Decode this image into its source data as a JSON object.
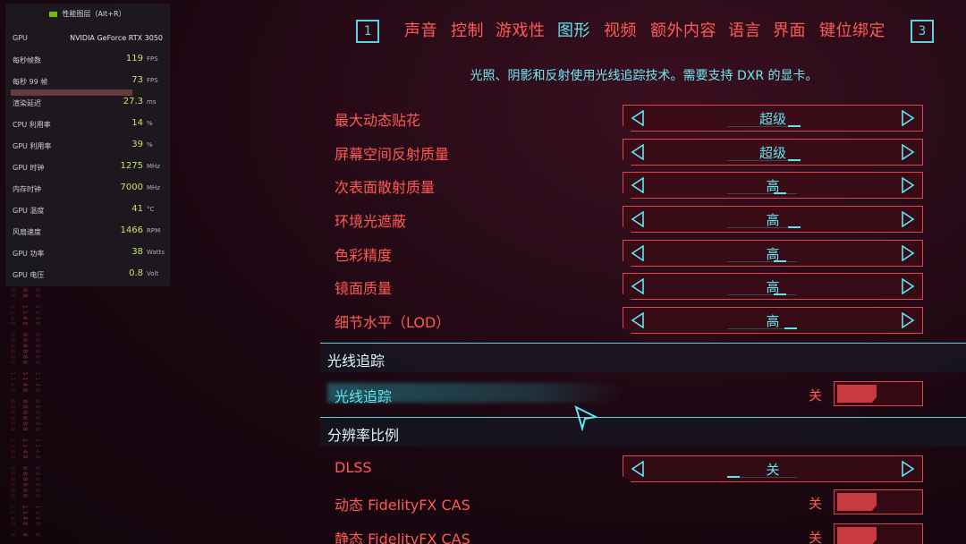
{
  "nav": {
    "left_key": "1",
    "right_key": "3",
    "tabs": [
      {
        "label": "声音",
        "active": false
      },
      {
        "label": "控制",
        "active": false
      },
      {
        "label": "游戏性",
        "active": false
      },
      {
        "label": "图形",
        "active": true
      },
      {
        "label": "视频",
        "active": false
      },
      {
        "label": "额外内容",
        "active": false
      },
      {
        "label": "语言",
        "active": false
      },
      {
        "label": "界面",
        "active": false
      },
      {
        "label": "键位绑定",
        "active": false
      }
    ]
  },
  "description": "光照、阴影和反射使用光线追踪技术。需要支持 DXR 的显卡。",
  "settings": [
    {
      "label": "最大动态贴花",
      "value": "超级"
    },
    {
      "label": "屏幕空间反射质量",
      "value": "超级"
    },
    {
      "label": "次表面散射质量",
      "value": "高"
    },
    {
      "label": "环境光遮蔽",
      "value": "高"
    },
    {
      "label": "色彩精度",
      "value": "高"
    },
    {
      "label": "镜面质量",
      "value": "高"
    },
    {
      "label": "细节水平（LOD）",
      "value": "高"
    }
  ],
  "raytracing_section": {
    "title": "光线追踪",
    "toggle_label": "光线追踪",
    "toggle_state": "关"
  },
  "resolution_section": {
    "title": "分辨率比例",
    "dlss_label": "DLSS",
    "dlss_value": "关",
    "dynamic_cas_label": "动态 FidelityFX CAS",
    "dynamic_cas_state": "关",
    "static_cas_label": "静态 FidelityFX CAS",
    "static_cas_state": "关"
  },
  "perf_overlay": {
    "title": "性能图层（Alt+R）",
    "gpu_label": "GPU",
    "gpu_name": "NVIDIA GeForce RTX 3050",
    "rows": [
      {
        "label": "每秒帧数",
        "value": "119",
        "unit": "FPS"
      },
      {
        "label": "每秒 99 帧",
        "value": "73",
        "unit": "FPS"
      },
      {
        "label": "渲染延迟",
        "value": "27.3",
        "unit": "ms"
      },
      {
        "label": "CPU 利用率",
        "value": "14",
        "unit": "%"
      },
      {
        "label": "GPU 利用率",
        "value": "39",
        "unit": "%"
      },
      {
        "label": "GPU 时钟",
        "value": "1275",
        "unit": "MHz"
      },
      {
        "label": "内存时钟",
        "value": "7000",
        "unit": "MHz"
      },
      {
        "label": "GPU 温度",
        "value": "41",
        "unit": "°C"
      },
      {
        "label": "风扇速度",
        "value": "1466",
        "unit": "RPM"
      },
      {
        "label": "GPU 功率",
        "value": "38",
        "unit": "Watts"
      },
      {
        "label": "GPU 电压",
        "value": "0.8",
        "unit": "Volt"
      }
    ]
  },
  "decor": {
    "code_text": "0B 1148 000000 1148 000000 1148 000000 1148 000000 EP"
  },
  "colors": {
    "accent_red": "#ff5a55",
    "accent_cyan": "#5fe6f0",
    "background": "#1c0812"
  }
}
